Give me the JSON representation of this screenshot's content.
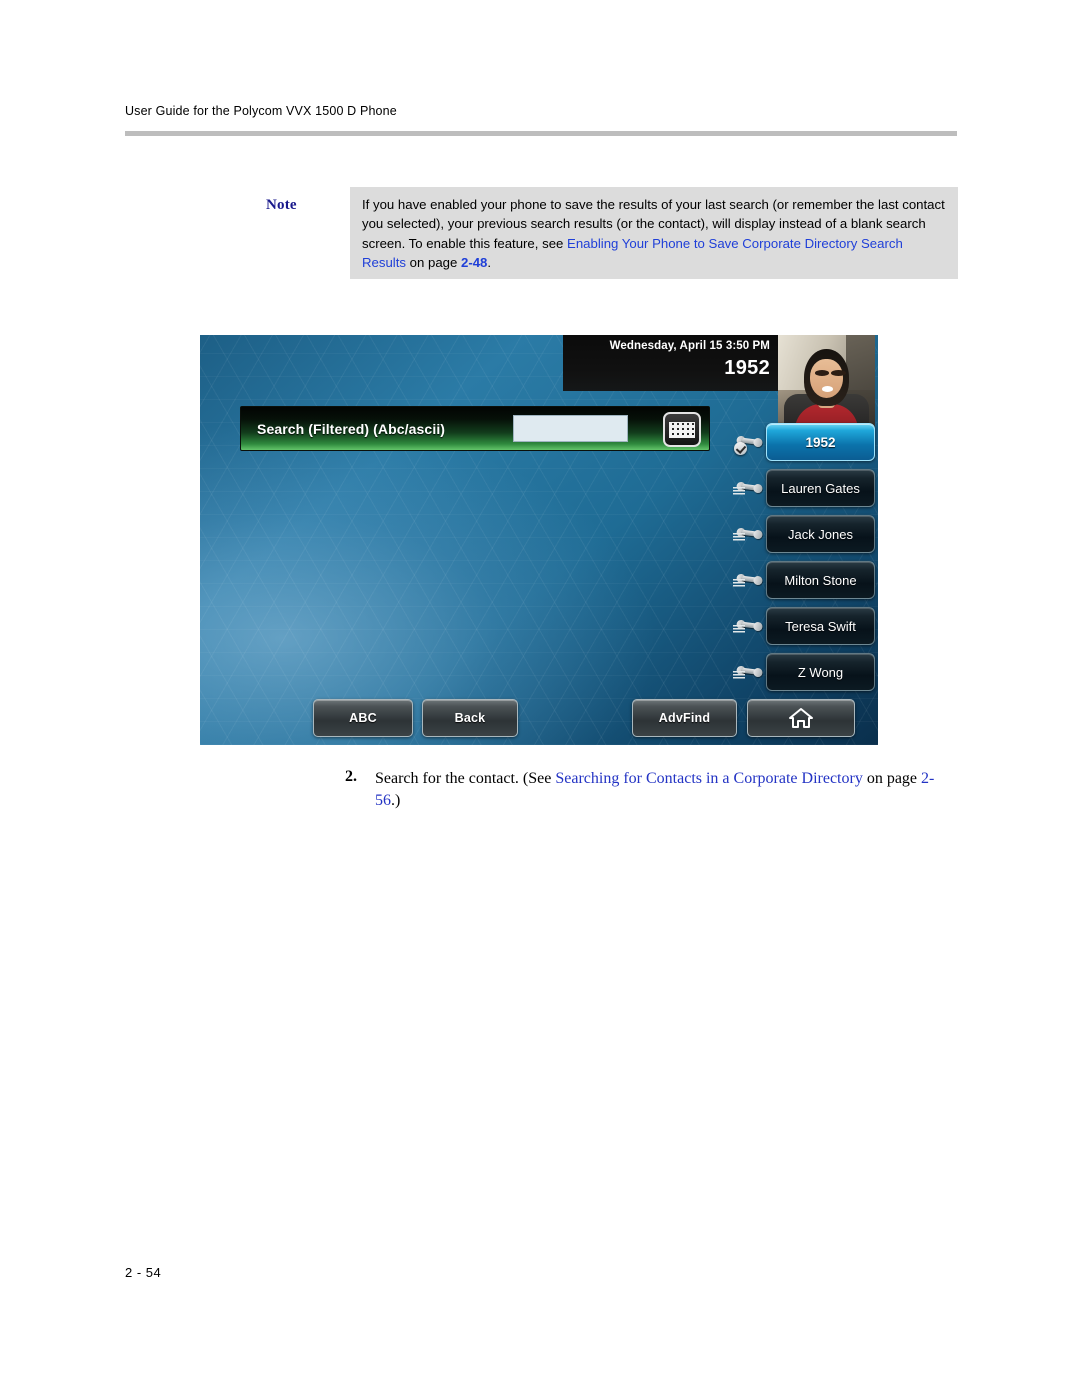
{
  "document": {
    "running_header": "User Guide for the Polycom VVX 1500 D Phone",
    "page_footer": "2 - 54"
  },
  "note": {
    "label": "Note",
    "text_part1": "If you have enabled your phone to save the results of your last search (or remember the last contact you selected), your previous search results (or the contact), will display instead of a blank search screen. To enable this feature, see ",
    "link_text": "Enabling Your Phone to Save Corporate Directory Search Results",
    "text_part2": " on page ",
    "page_ref": "2-48",
    "text_part3": ".",
    "link_color": "#1f3fd8",
    "label_color": "#1a1a8c",
    "background": "#dcdcdc"
  },
  "phone_screen": {
    "status": {
      "datetime": "Wednesday, April 15  3:50 PM",
      "extension": "1952"
    },
    "search": {
      "label": "Search (Filtered) (Abc/ascii)",
      "value": "",
      "keyboard_icon": "keyboard-icon"
    },
    "line_keys": [
      {
        "label": "1952",
        "icon": "handset-registered-icon",
        "active": true
      },
      {
        "label": "Lauren Gates",
        "icon": "handset-icon",
        "active": false
      },
      {
        "label": "Jack Jones",
        "icon": "handset-icon",
        "active": false
      },
      {
        "label": "Milton Stone",
        "icon": "handset-icon",
        "active": false
      },
      {
        "label": "Teresa Swift",
        "icon": "handset-icon",
        "active": false
      },
      {
        "label": "Z Wong",
        "icon": "handset-icon",
        "active": false
      }
    ],
    "softkeys": [
      {
        "label": "ABC",
        "icon": null
      },
      {
        "label": "Back",
        "icon": null
      },
      {
        "label": "AdvFind",
        "icon": null
      },
      {
        "label": "",
        "icon": "home-icon"
      }
    ],
    "accent_color": "#1fa7da",
    "background_color": "#1f6c95"
  },
  "step": {
    "number": "2.",
    "text_part1": "Search for the contact. (See ",
    "link_text": "Searching for Contacts in a Corporate Directory",
    "text_part2": " on page ",
    "page_ref": "2-56",
    "text_part3": ".)",
    "link_color": "#2333c4"
  }
}
